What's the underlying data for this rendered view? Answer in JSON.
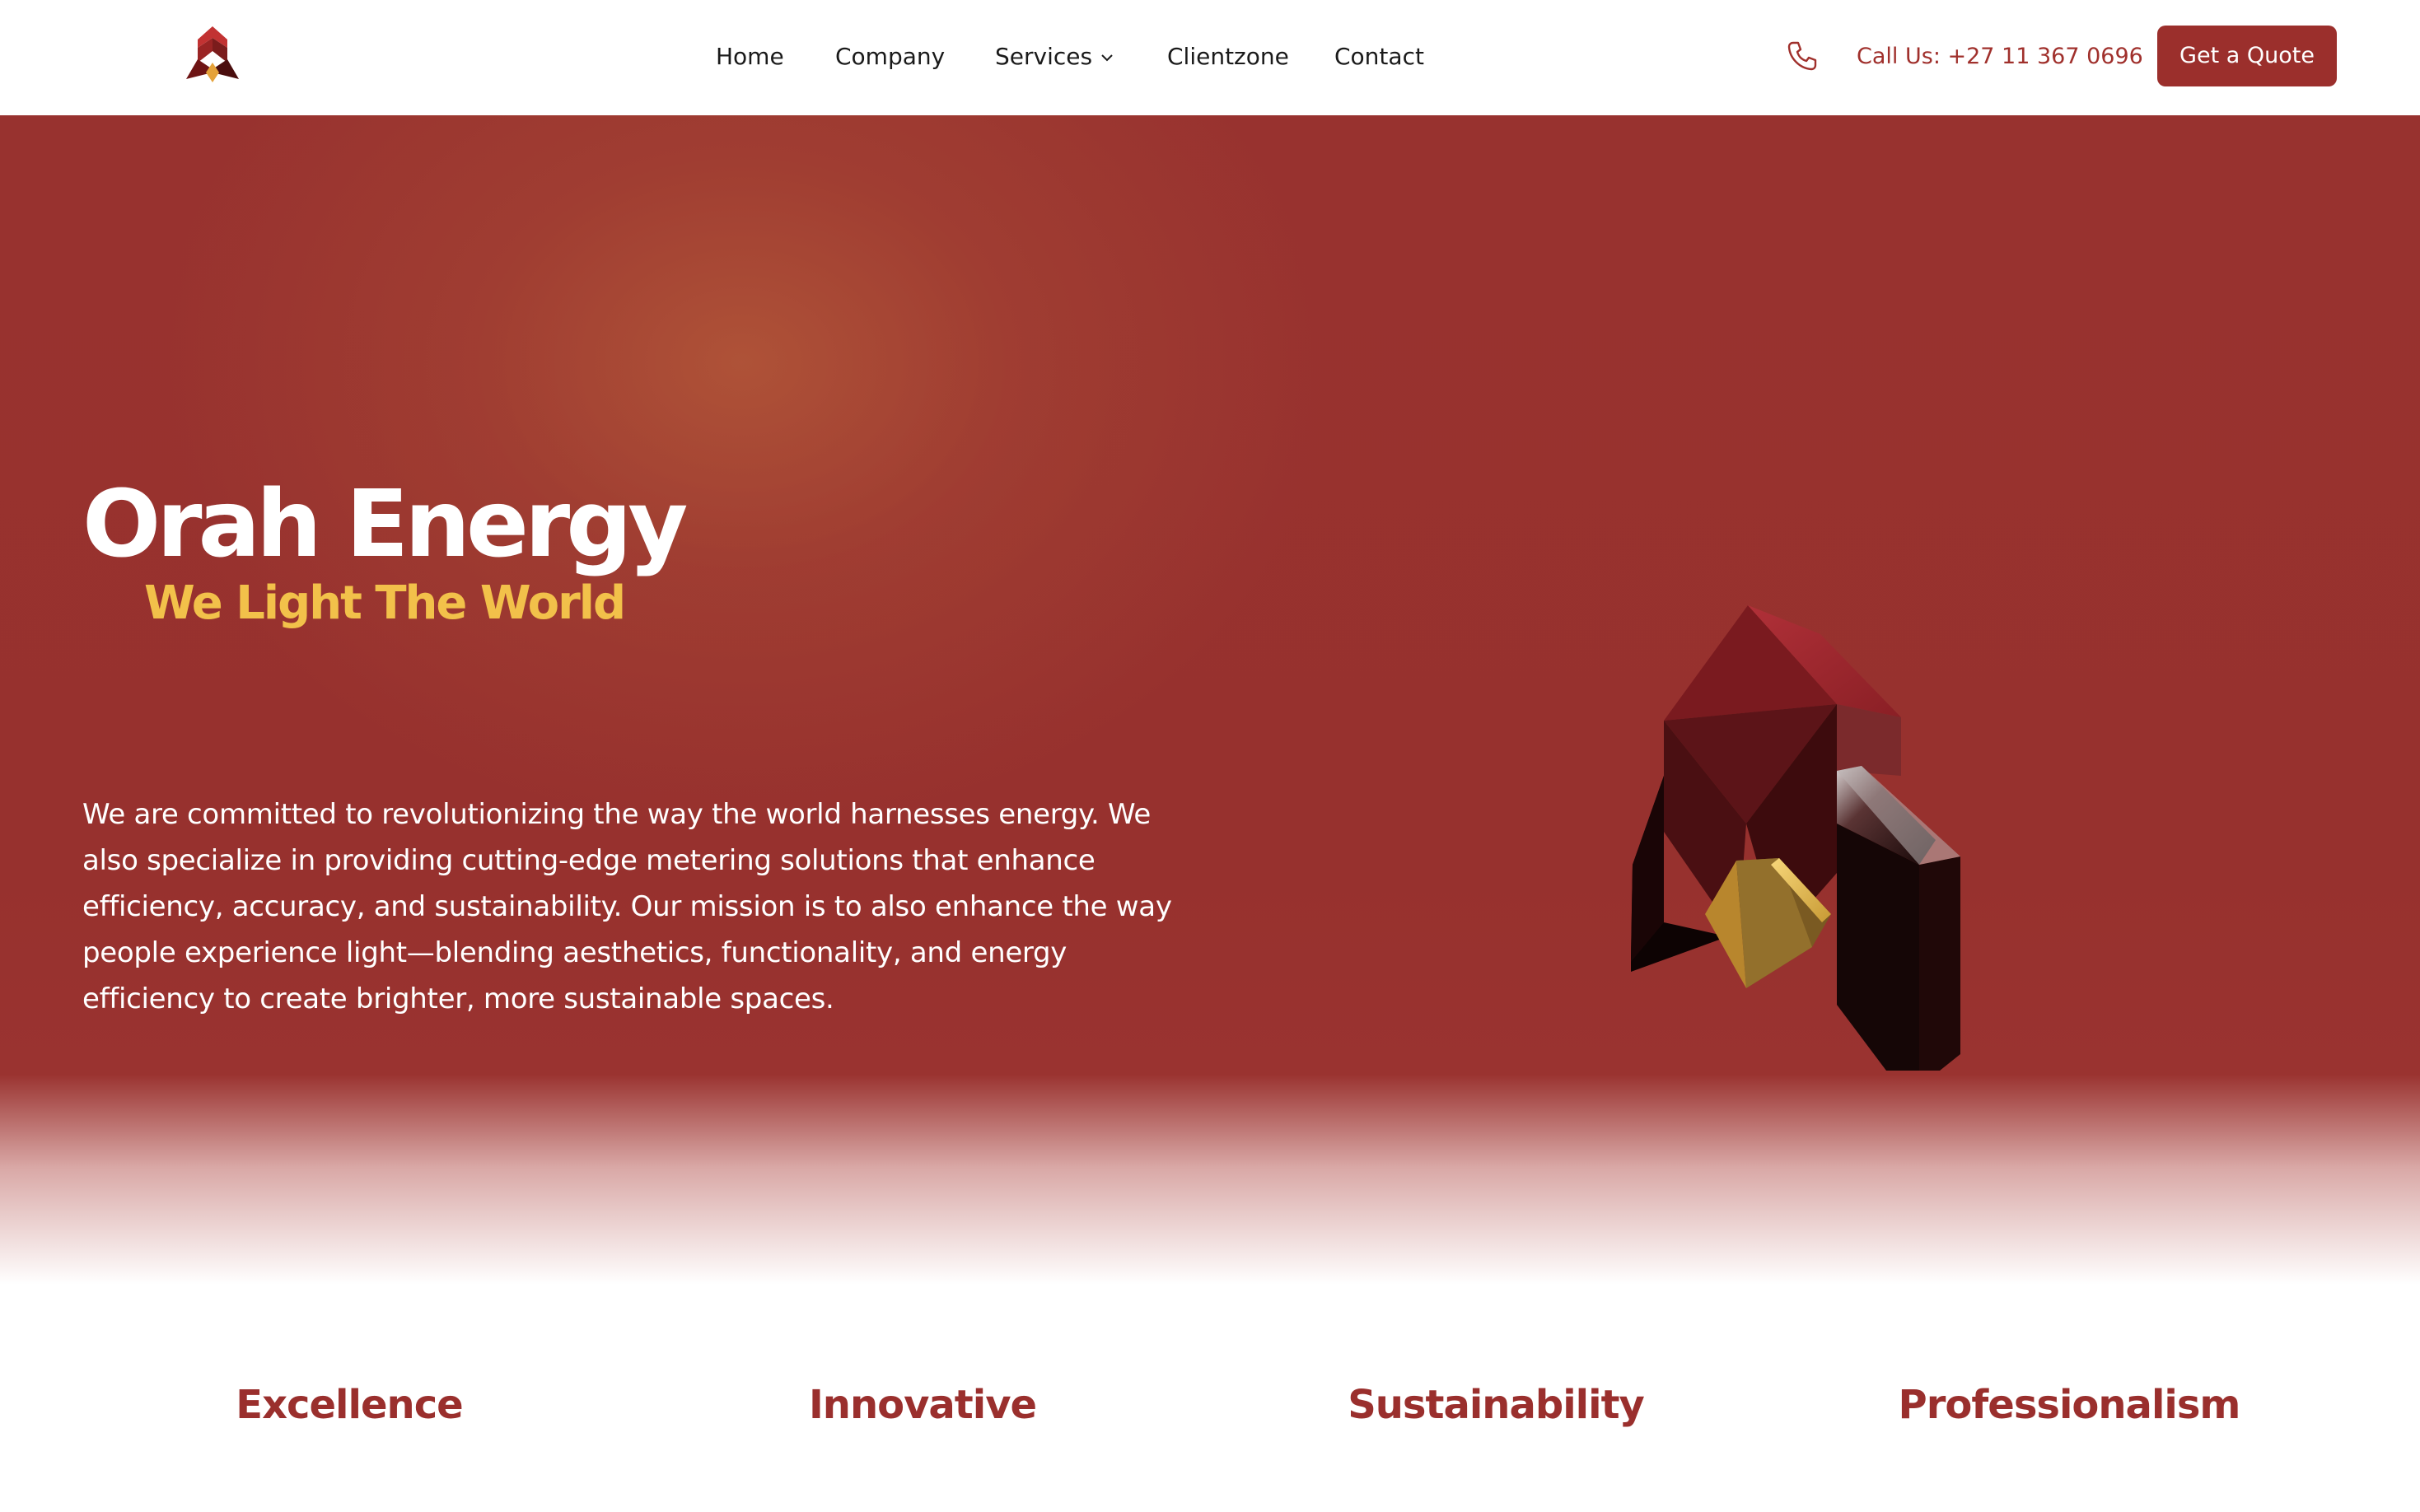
{
  "header": {
    "logo_icon": "orah-energy-logo",
    "nav": [
      {
        "label": "Home"
      },
      {
        "label": "Company"
      },
      {
        "label": "Services",
        "icon": "chevron-down-icon"
      },
      {
        "label": "Clientzone"
      },
      {
        "label": "Contact"
      }
    ],
    "phone_icon": "phone-icon",
    "call_text": "Call Us: +27 11 367 0696",
    "quote_button": "Get a Quote"
  },
  "hero": {
    "title": "Orah Energy",
    "subtitle": "We Light The World",
    "description": "We are committed to revolutionizing the way the world harnesses energy. We also specialize in providing cutting-edge metering solutions that enhance efficiency, accuracy, and sustainability. Our mission is to also enhance the way people experience light—blending aesthetics, functionality, and energy efficiency to create brighter, more sustainable spaces.",
    "illustration": "3d-logo-emblem"
  },
  "values": [
    {
      "label": "Excellence"
    },
    {
      "label": "Innovative"
    },
    {
      "label": "Sustainability"
    },
    {
      "label": "Professionalism"
    }
  ],
  "colors": {
    "brand": "#9b2f2c",
    "accent_gold": "#f2c14a",
    "hero_bg": "#98322f",
    "text_dark": "#1a1a1a"
  }
}
